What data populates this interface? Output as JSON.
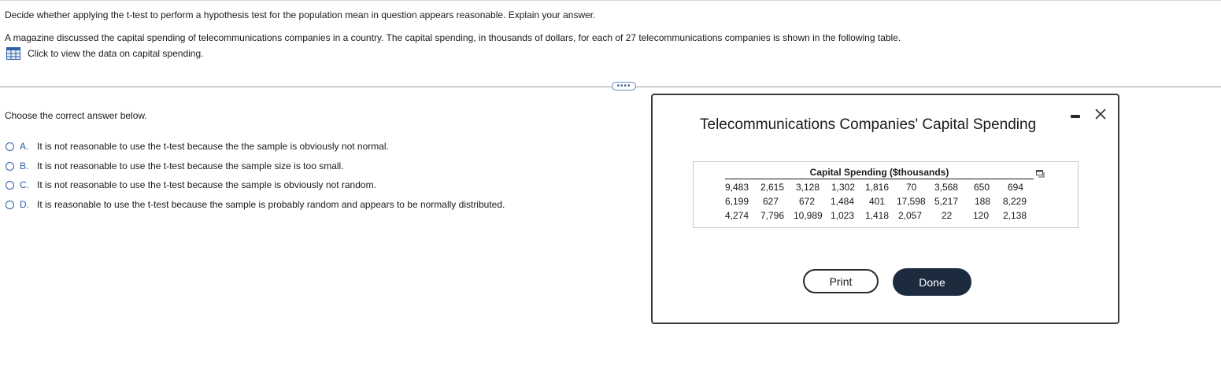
{
  "question": {
    "prompt": "Decide whether applying the t-test to perform a hypothesis test for the population mean in question appears reasonable. Explain your answer.",
    "context": "A magazine discussed the capital spending of telecommunications companies in a country. The capital spending, in thousands of dollars, for each of 27 telecommunications companies is shown in the following table.",
    "data_link_label": "Click to view the data on capital spending.",
    "more_button_label": "••••",
    "instruction": "Choose the correct answer below.",
    "options": [
      {
        "letter": "A.",
        "text": "It is not reasonable to use the t-test because the the sample is obviously not normal."
      },
      {
        "letter": "B.",
        "text": "It is not reasonable to use the t-test because the sample size is too small."
      },
      {
        "letter": "C.",
        "text": "It is not reasonable to use the t-test because the sample is obviously not random."
      },
      {
        "letter": "D.",
        "text": "It is reasonable to use the t-test because the sample is probably random and appears to be normally distributed."
      }
    ]
  },
  "modal": {
    "title": "Telecommunications Companies' Capital Spending",
    "table_header": "Capital Spending ($thousands)",
    "rows": [
      [
        "9,483",
        "2,615",
        "3,128",
        "1,302",
        "1,816",
        "70",
        "3,568",
        "650",
        "694"
      ],
      [
        "6,199",
        "627",
        "672",
        "1,484",
        "401",
        "17,598",
        "5,217",
        "188",
        "8,229"
      ],
      [
        "4,274",
        "7,796",
        "10,989",
        "1,023",
        "1,418",
        "2,057",
        "22",
        "120",
        "2,138"
      ]
    ],
    "print_label": "Print",
    "done_label": "Done"
  },
  "icons": {
    "data_link": "grid-table-icon",
    "minimize": "minimize-icon",
    "close": "close-icon",
    "copy": "copy-icon"
  },
  "colors": {
    "accent": "#2f5fa7",
    "done_button": "#1c2b3e"
  }
}
